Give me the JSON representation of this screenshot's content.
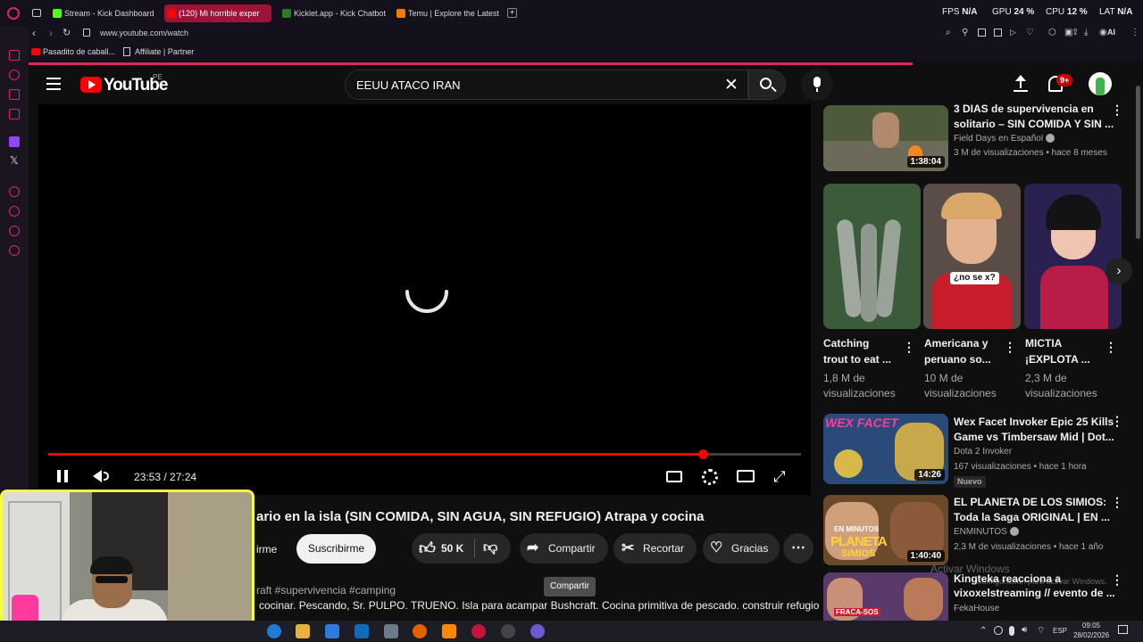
{
  "browser": {
    "tabs": [
      {
        "label": "Stream - Kick Dashboard",
        "color": "#53fc18"
      },
      {
        "label": "(120) Mi horrible exper",
        "color": "#ff0000"
      },
      {
        "label": "Kicklet.app - Kick Chatbot",
        "color": "#2b7a2b"
      },
      {
        "label": "Temu | Explore the Latest",
        "color": "#f57c00"
      }
    ],
    "url": "www.youtube.com/watch",
    "bookmarks": [
      "Pasadito de caball...",
      "Affiliate | Partner"
    ],
    "stats": {
      "fps_label": "FPS",
      "fps_val": "N/A",
      "gpu_label": "GPU",
      "gpu_val": "24 %",
      "cpu_label": "CPU",
      "cpu_val": "12 %",
      "lat_label": "LAT",
      "lat_val": "N/A"
    },
    "ai_label": "AI"
  },
  "header": {
    "logo_text": "YouTube",
    "region": "PE",
    "search_value": "EEUU ATACO IRAN",
    "notif_badge": "9+"
  },
  "player": {
    "time": "23:53 / 27:24",
    "progress": 0.87
  },
  "video": {
    "title": "ario en la isla (SIN COMIDA, SIN AGUA, SIN REFUGIO) Atrapa y cocina",
    "subscribe_partial": "irme",
    "subscribe": "Suscribirme",
    "likes": "50 K",
    "share": "Compartir",
    "clip": "Recortar",
    "thanks": "Gracias",
    "tooltip": "Compartir",
    "hashtags": "raft #supervivencia #camping",
    "description": "cocinar. Pescando, Sr. PULPO. TRUENO. Isla para acampar Bushcraft. Cocina primitiva de pescado. construir refugio"
  },
  "sidebar": {
    "top": {
      "title1": "3 DIAS de supervivencia en",
      "title2": "solitario – SIN COMIDA Y SIN ...",
      "channel": "Field Days en Español",
      "meta": "3 M de visualizaciones • hace 8 meses",
      "duration": "1:38:04"
    },
    "shorts": [
      {
        "title1": "Catching",
        "title2": "trout to eat ...",
        "views1": "1,8 M de",
        "views2": "visualizaciones"
      },
      {
        "title1": "Americana y",
        "title2": "peruano so...",
        "views1": "10 M de",
        "views2": "visualizaciones",
        "sticker": "¿no se x?"
      },
      {
        "title1": "MICTIA",
        "title2": "¡EXPLOTA ...",
        "views1": "2,3 M de",
        "views2": "visualizaciones"
      }
    ],
    "items": [
      {
        "title1": "Wex Facet Invoker Epic 25 Kills",
        "title2": "Game vs Timbersaw Mid | Dot...",
        "channel": "Dota 2 Invoker",
        "meta": "167 visualizaciones • hace 1 hora",
        "badge": "Nuevo",
        "duration": "14:26",
        "thumb_text": "WEX FACET"
      },
      {
        "title1": "EL PLANETA DE LOS SIMIOS:",
        "title2": "Toda la Saga ORIGINAL | EN ...",
        "channel": "ENMINUTOS",
        "meta": "2,3 M de visualizaciones • hace 1 año",
        "duration": "1:40:40",
        "thumb_text1": "EN MINUTOS",
        "thumb_text2": "PLANETA",
        "thumb_text3": "SIMIOS"
      },
      {
        "title1": "Kingteka reacciona a",
        "title2": "vixoxelstreaming // evento de ...",
        "channel": "FekaHouse",
        "thumb_text": "FRACA-SOS"
      }
    ]
  },
  "watermark": {
    "line1": "Activar Windows",
    "line2": "Configuración para activar Windows."
  },
  "taskbar": {
    "lang": "ESP",
    "time": "09:05",
    "date": "28/02/2026"
  }
}
